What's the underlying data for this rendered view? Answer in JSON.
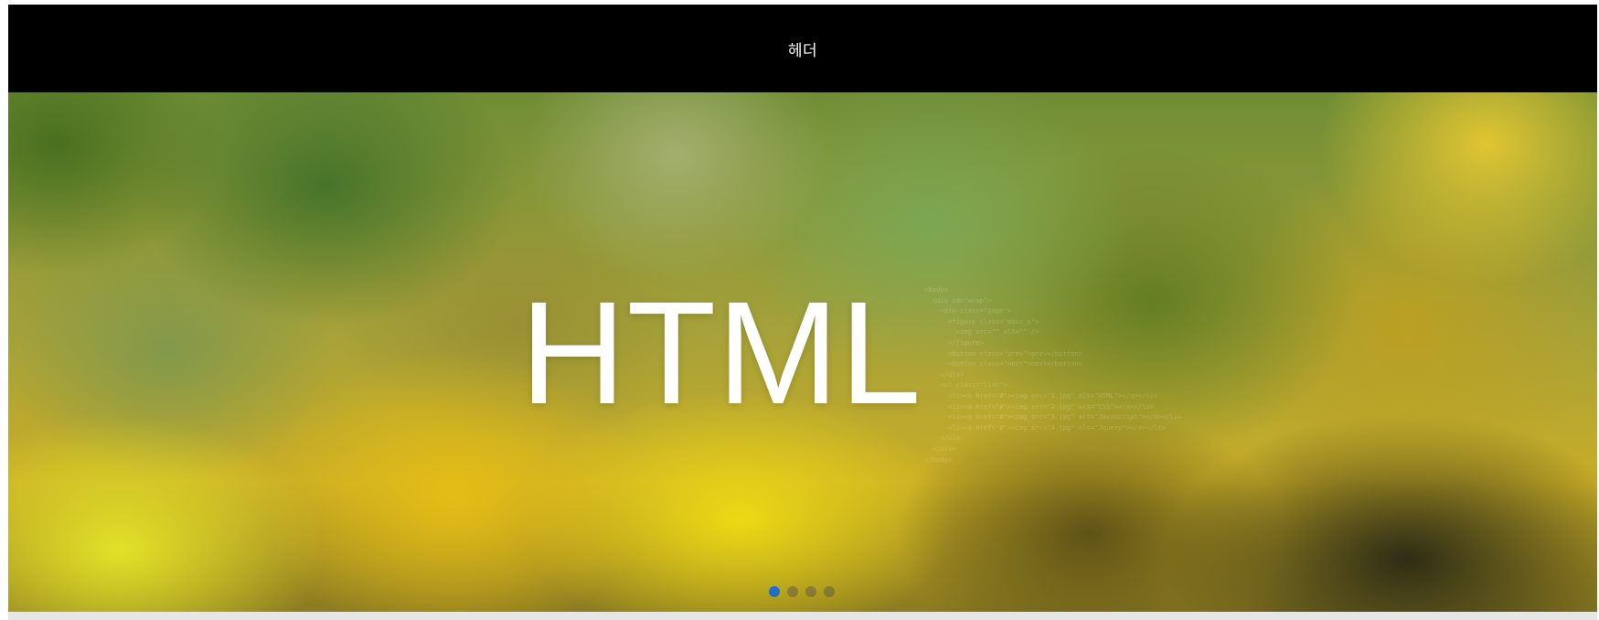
{
  "header": {
    "title": "헤더"
  },
  "slider": {
    "title": "HTML",
    "code_lines": [
      "<body>",
      "  <div id=\"wrap\">",
      "    <div class=\"page\">",
      "      <figure class=\"main_v\">",
      "        <img src=\"\" alt=\"\" />",
      "      </figure>",
      "      <button class=\"prev\">prev</button>",
      "      <button class=\"next\">next</button>",
      "    </div>",
      "    <ul class=\"list\">",
      "      <li><a href=\"#\"><img src=\"1.jpg\" alt=\"HTML\"></a></li>",
      "      <li><a href=\"#\"><img src=\"2.jpg\" alt=\"CSS\"></a></li>",
      "      <li><a href=\"#\"><img src=\"3.jpg\" alt=\"Javascript\"></a></li>",
      "      <li><a href=\"#\"><img src=\"4.jpg\" alt=\"Jquery\"></a></li>",
      "    </ul>",
      "  </div>",
      "</body>"
    ],
    "dots": [
      {
        "label": "1",
        "active": true
      },
      {
        "label": "2",
        "active": false
      },
      {
        "label": "3",
        "active": false
      },
      {
        "label": "4",
        "active": false
      }
    ]
  },
  "colors": {
    "header_background": "#000000",
    "dot_active": "#1f6fc8",
    "dot_inactive": "#6e6e6e",
    "footer_strip": "#e6e6e6"
  }
}
